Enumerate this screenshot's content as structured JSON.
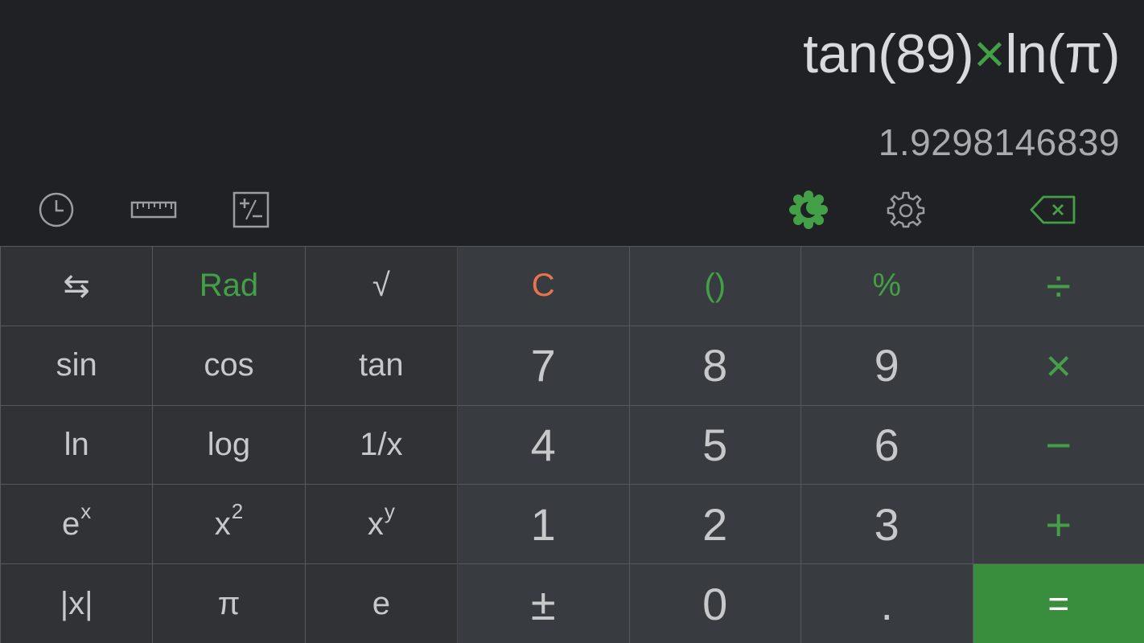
{
  "display": {
    "expression_left": "tan(89)",
    "expression_op": "×",
    "expression_right": "ln(π)",
    "result": "1.9298146839"
  },
  "toolbar": {
    "icons": [
      "history-icon",
      "ruler-icon",
      "plus-minus-box-icon",
      "theme-moon-icon",
      "gear-icon",
      "backspace-icon"
    ]
  },
  "scientific_keys": {
    "row1": [
      "⇆",
      "Rad",
      "√"
    ],
    "row2": [
      "sin",
      "cos",
      "tan"
    ],
    "row3": [
      "ln",
      "log",
      "1/x"
    ],
    "row4_base": [
      "e",
      "x",
      "x"
    ],
    "row4_exp": [
      "x",
      "2",
      "y"
    ],
    "row5": [
      "|x|",
      "π",
      "e"
    ]
  },
  "number_keys": {
    "row1": [
      "C",
      "()",
      "%",
      "÷"
    ],
    "row2": [
      "7",
      "8",
      "9",
      "×"
    ],
    "row3": [
      "4",
      "5",
      "6",
      "−"
    ],
    "row4": [
      "1",
      "2",
      "3",
      "+"
    ],
    "row5": [
      "±",
      "0",
      ".",
      "="
    ]
  },
  "colors": {
    "accent_green": "#43a047",
    "clear_orange": "#e8734f",
    "equals_bg": "#388e3c",
    "background": "#202124"
  }
}
